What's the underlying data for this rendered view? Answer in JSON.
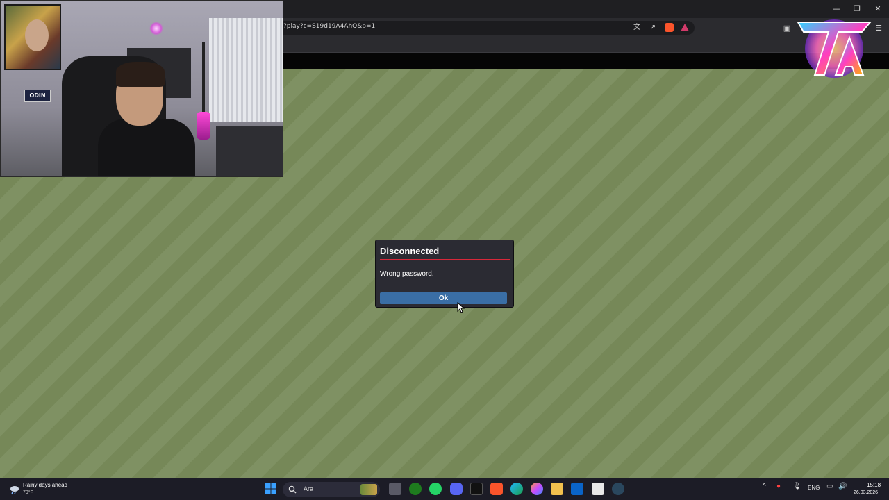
{
  "browser": {
    "url": "?play?c=S19d19A4AhQ&p=1",
    "window_controls": [
      "minimize",
      "restore",
      "close"
    ]
  },
  "webcam": {
    "sign_text": "ODIN"
  },
  "dialog": {
    "title": "Disconnected",
    "message": "Wrong password.",
    "ok_label": "Ok",
    "title_underline_color": "#d8283a",
    "button_color": "#3a6ea5"
  },
  "taskbar": {
    "weather_title": "Rainy days ahead",
    "weather_temp": "79°F",
    "search_placeholder": "Ara",
    "language": "ENG",
    "time": "15:18",
    "date": "26.03.2026",
    "apps": [
      "windows-start-icon",
      "search-icon",
      "game-icon",
      "file-explorer-icon",
      "xbox-icon",
      "whatsapp-icon",
      "discord-icon",
      "terminal-icon",
      "brave-icon",
      "edge-icon",
      "copilot-icon",
      "folder-icon",
      "outlook-icon",
      "store-icon",
      "steam-icon"
    ]
  }
}
